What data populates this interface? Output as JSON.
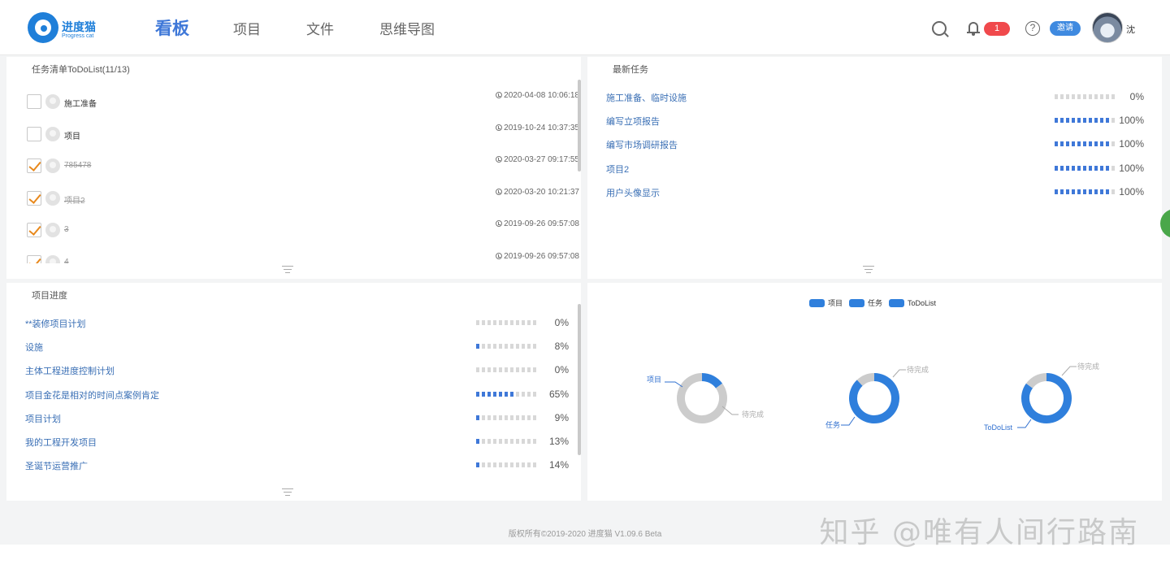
{
  "header": {
    "logo_name": "进度猫",
    "logo_sub": "Progress cat",
    "nav": [
      "看板",
      "项目",
      "文件",
      "思维导图"
    ],
    "notification_count": "1",
    "help_glyph": "?",
    "invite_label": "邀请",
    "user_name": "沈"
  },
  "todo": {
    "title": "任务清单ToDoList(11/13)",
    "items": [
      {
        "label": "施工准备",
        "time": "2020-04-08 10:06:18",
        "done": false
      },
      {
        "label": "项目",
        "time": "2019-10-24 10:37:35",
        "done": false
      },
      {
        "label": "785478",
        "time": "2020-03-27 09:17:55",
        "done": true
      },
      {
        "label": "项目2",
        "time": "2020-03-20 10:21:37",
        "done": true
      },
      {
        "label": "3",
        "time": "2019-09-26 09:57:08",
        "done": true
      },
      {
        "label": "4",
        "time": "2019-09-26 09:57:08",
        "done": true
      }
    ]
  },
  "latest": {
    "title": "最新任务",
    "items": [
      {
        "label": "施工准备、临时设施",
        "progress": 0,
        "pct": "0%"
      },
      {
        "label": "编写立项报告",
        "progress": 100,
        "pct": "100%"
      },
      {
        "label": "编写市场调研报告",
        "progress": 100,
        "pct": "100%"
      },
      {
        "label": "项目2",
        "progress": 100,
        "pct": "100%"
      },
      {
        "label": "用户头像显示",
        "progress": 100,
        "pct": "100%"
      }
    ]
  },
  "progress": {
    "title": "项目进度",
    "items": [
      {
        "label": "**装修项目计划",
        "progress": 0,
        "pct": "0%"
      },
      {
        "label": "设施",
        "progress": 8,
        "pct": "8%"
      },
      {
        "label": "主体工程进度控制计划",
        "progress": 0,
        "pct": "0%"
      },
      {
        "label": "项目金花是相对的时间点案例肯定",
        "progress": 65,
        "pct": "65%"
      },
      {
        "label": "项目计划",
        "progress": 9,
        "pct": "9%"
      },
      {
        "label": "我的工程开发项目",
        "progress": 13,
        "pct": "13%"
      },
      {
        "label": "圣诞节运营推广",
        "progress": 14,
        "pct": "14%"
      }
    ]
  },
  "chart_data": {
    "type": "pie",
    "legend": [
      "项目",
      "任务",
      "ToDoList"
    ],
    "legend_position": "top-center",
    "charts": [
      {
        "name": "项目",
        "slices": [
          {
            "label": "项目",
            "value": 15
          },
          {
            "label": "待完成",
            "value": 85
          }
        ]
      },
      {
        "name": "任务",
        "slices": [
          {
            "label": "任务",
            "value": 88
          },
          {
            "label": "待完成",
            "value": 12
          }
        ]
      },
      {
        "name": "ToDoList",
        "slices": [
          {
            "label": "ToDoList",
            "value": 85
          },
          {
            "label": "待完成",
            "value": 15
          }
        ]
      }
    ],
    "colors": {
      "done": "#2f7fdc",
      "pending": "#cccccc"
    }
  },
  "footer": {
    "copyright": "版权所有©2019-2020 进度猫 V1.09.6 Beta",
    "watermark": "知乎 @唯有人间行路南"
  }
}
